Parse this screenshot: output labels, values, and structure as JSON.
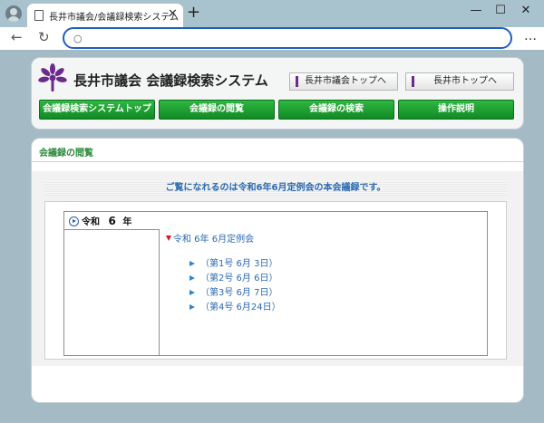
{
  "browser": {
    "tab_title": "長井市議会/会議録検索システム",
    "tab_close": "✕",
    "new_tab": "+",
    "minimize": "—",
    "maximize": "☐",
    "close": "✕",
    "back": "←",
    "reload": "↻",
    "search_icon": "○",
    "menu": "…",
    "url_value": ""
  },
  "header": {
    "title": "長井市議会  会議録検索システム",
    "links": [
      {
        "label": "長井市議会トップへ"
      },
      {
        "label": "長井市トップへ"
      }
    ],
    "nav": [
      {
        "label": "会議録検索システムトップ"
      },
      {
        "label": "会議録の閲覧"
      },
      {
        "label": "会議録の検索"
      },
      {
        "label": "操作説明"
      }
    ]
  },
  "content": {
    "section_title": "会議録の閲覧",
    "notice": "ご覧になれるのは令和6年6月定例会の本会議録です。",
    "era": {
      "prefix": "令和",
      "year": "6",
      "suffix": "年"
    },
    "session": "令和 6年 6月定例会",
    "issues": [
      {
        "label": "（第1号 6月 3日）"
      },
      {
        "label": "（第2号 6月 6日）"
      },
      {
        "label": "（第3号 6月 7日）"
      },
      {
        "label": "（第4号 6月24日）"
      }
    ]
  },
  "colors": {
    "brand_purple": "#6c2a8c",
    "nav_green": "#1a9b2e",
    "link_blue": "#2b6ab0",
    "marker_red": "#d6152a"
  }
}
